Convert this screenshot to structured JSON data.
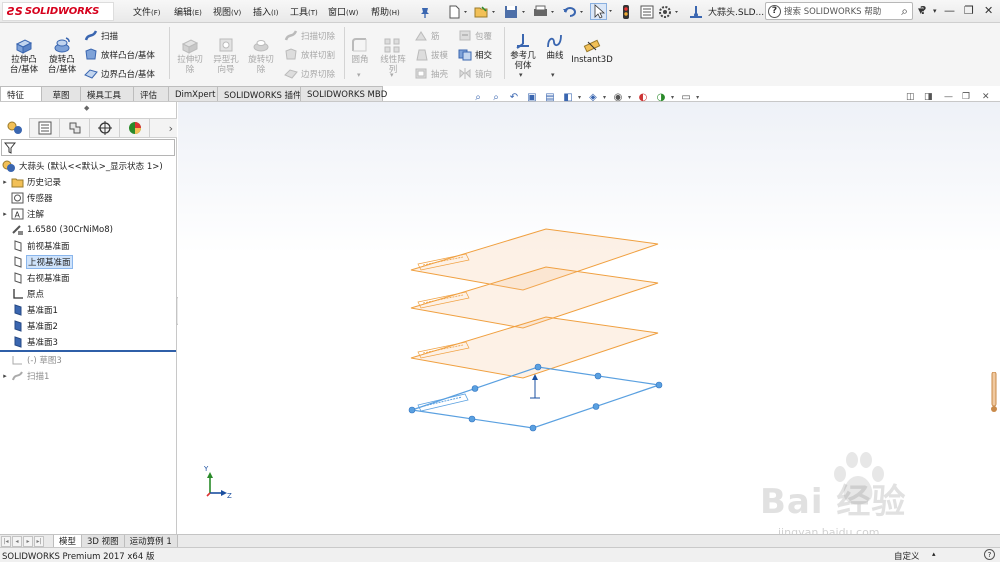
{
  "app": {
    "logo_text": "SOLIDWORKS",
    "doc_title": "大蒜头.SLD..."
  },
  "menu": [
    {
      "label": "文件",
      "key": "(F)"
    },
    {
      "label": "编辑",
      "key": "(E)"
    },
    {
      "label": "视图",
      "key": "(V)"
    },
    {
      "label": "插入",
      "key": "(I)"
    },
    {
      "label": "工具",
      "key": "(T)"
    },
    {
      "label": "窗口",
      "key": "(W)"
    },
    {
      "label": "帮助",
      "key": "(H)"
    }
  ],
  "search": {
    "placeholder": "搜索 SOLIDWORKS 帮助"
  },
  "commands": {
    "extrude_boss": "拉伸凸\n台/基体",
    "revolve_boss": "旋转凸\n台/基体",
    "sweep": "扫描",
    "loft_boss": "放样凸台/基体",
    "boundary_boss": "边界凸台/基体",
    "extrude_cut": "拉伸切\n除",
    "hole_wizard": "异型孔\n向导",
    "revolve_cut": "旋转切\n除",
    "sweep_cut": "扫描切除",
    "loft_cut": "放样切割",
    "boundary_cut": "边界切除",
    "fillet": "圆角",
    "linear_pattern": "线性阵\n列",
    "rib": "筋",
    "draft": "拔模",
    "shell": "抽壳",
    "wrap": "包覆",
    "intersect": "相交",
    "mirror": "镜向",
    "ref_geometry": "参考几\n何体",
    "curves": "曲线",
    "instant3d": "Instant3D"
  },
  "tabs": [
    "特征",
    "草图",
    "模具工具",
    "评估",
    "DimXpert",
    "SOLIDWORKS 插件",
    "SOLIDWORKS MBD"
  ],
  "active_tab": 0,
  "tree": {
    "root": "大蒜头 (默认<<默认>_显示状态 1>)",
    "items": [
      {
        "label": "历史记录",
        "icon": "history-icon",
        "expand": true
      },
      {
        "label": "传感器",
        "icon": "sensor-icon",
        "expand": false
      },
      {
        "label": "注解",
        "icon": "annotation-icon",
        "expand": true
      },
      {
        "label": "1.6580 (30CrNiMo8)",
        "icon": "material-icon",
        "expand": false
      },
      {
        "label": "前视基准面",
        "icon": "plane-icon",
        "expand": false
      },
      {
        "label": "上视基准面",
        "icon": "plane-icon",
        "expand": false,
        "selected": true
      },
      {
        "label": "右视基准面",
        "icon": "plane-icon",
        "expand": false
      },
      {
        "label": "原点",
        "icon": "origin-icon",
        "expand": false
      },
      {
        "label": "基准面1",
        "icon": "plane-solid-icon",
        "expand": false
      },
      {
        "label": "基准面2",
        "icon": "plane-solid-icon",
        "expand": false
      },
      {
        "label": "基准面3",
        "icon": "plane-solid-icon",
        "expand": false
      },
      {
        "label": "(-) 草图3",
        "icon": "sketch-icon",
        "expand": false,
        "grey": true
      },
      {
        "label": "扫描1",
        "icon": "sweep-icon",
        "expand": true,
        "grey": true
      }
    ]
  },
  "model_tabs": [
    "模型",
    "3D 视图",
    "运动算例 1"
  ],
  "status": {
    "left": "SOLIDWORKS Premium 2017 x64 版",
    "right": "自定义"
  },
  "triad": {
    "y": "Y",
    "z": "Z"
  },
  "watermark": {
    "text": "Bai 经验",
    "url": "jingyan.baidu.com"
  },
  "colors": {
    "accent_orange": "#f0a040",
    "sketch_blue": "#5aa0e0",
    "selection_bg": "#cfe3fb",
    "logo_red": "#d6001c"
  }
}
